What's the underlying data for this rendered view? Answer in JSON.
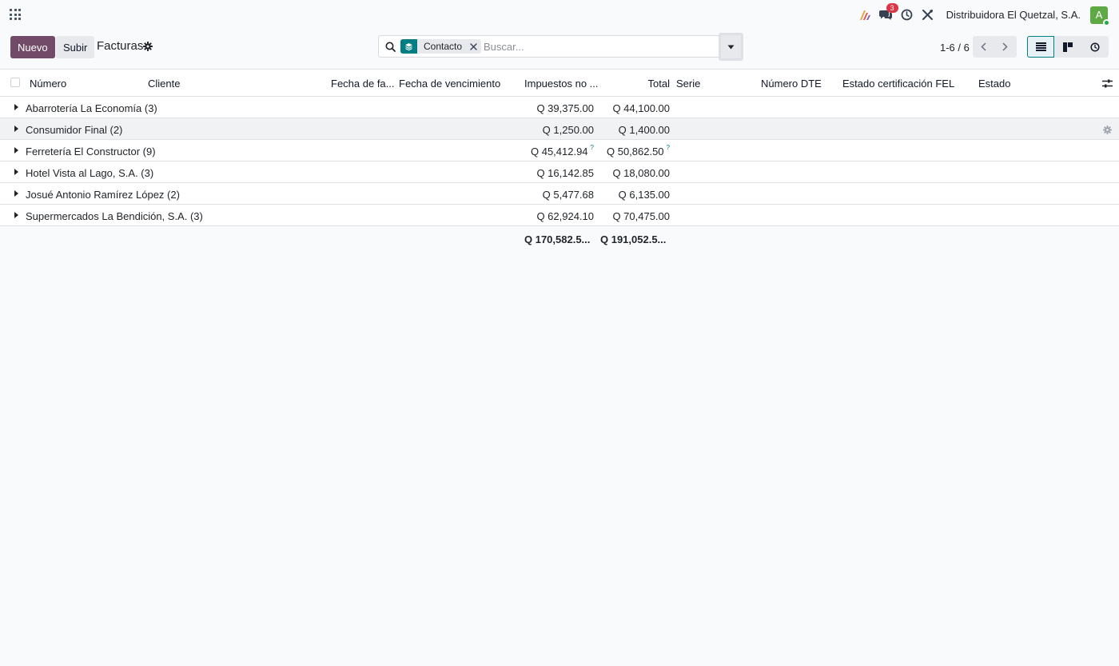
{
  "navbar": {
    "notification_count": "3",
    "company": "Distribuidora El Quetzal, S.A.",
    "avatar_initial": "A"
  },
  "control": {
    "new_label": "Nuevo",
    "upload_label": "Subir",
    "title": "Facturas",
    "facet_label": "Contacto",
    "search_placeholder": "Buscar...",
    "pager": "1-6 / 6"
  },
  "columns": {
    "numero": "Número",
    "cliente": "Cliente",
    "fecha_factura": "Fecha de fa...",
    "fecha_vencimiento": "Fecha de vencimiento",
    "impuestos": "Impuestos no ...",
    "total": "Total",
    "serie": "Serie",
    "numero_dte": "Número DTE",
    "estado_fel": "Estado certificación FEL",
    "estado": "Estado"
  },
  "groups": [
    {
      "name": "Abarrotería La Economía (3)",
      "untaxed": "Q 39,375.00",
      "total": "Q 44,100.00",
      "mark": ""
    },
    {
      "name": "Consumidor Final (2)",
      "untaxed": "Q 1,250.00",
      "total": "Q 1,400.00",
      "mark": ""
    },
    {
      "name": "Ferretería El Constructor (9)",
      "untaxed": "Q 45,412.94",
      "total": "Q 50,862.50",
      "mark": "?"
    },
    {
      "name": "Hotel Vista al Lago, S.A. (3)",
      "untaxed": "Q 16,142.85",
      "total": "Q 18,080.00",
      "mark": ""
    },
    {
      "name": "Josué Antonio Ramírez López (2)",
      "untaxed": "Q 5,477.68",
      "total": "Q 6,135.00",
      "mark": ""
    },
    {
      "name": "Supermercados La Bendición, S.A. (3)",
      "untaxed": "Q 62,924.10",
      "total": "Q 70,475.00",
      "mark": ""
    }
  ],
  "totals": {
    "untaxed": "Q 170,582.5...",
    "total": "Q 191,052.5..."
  }
}
